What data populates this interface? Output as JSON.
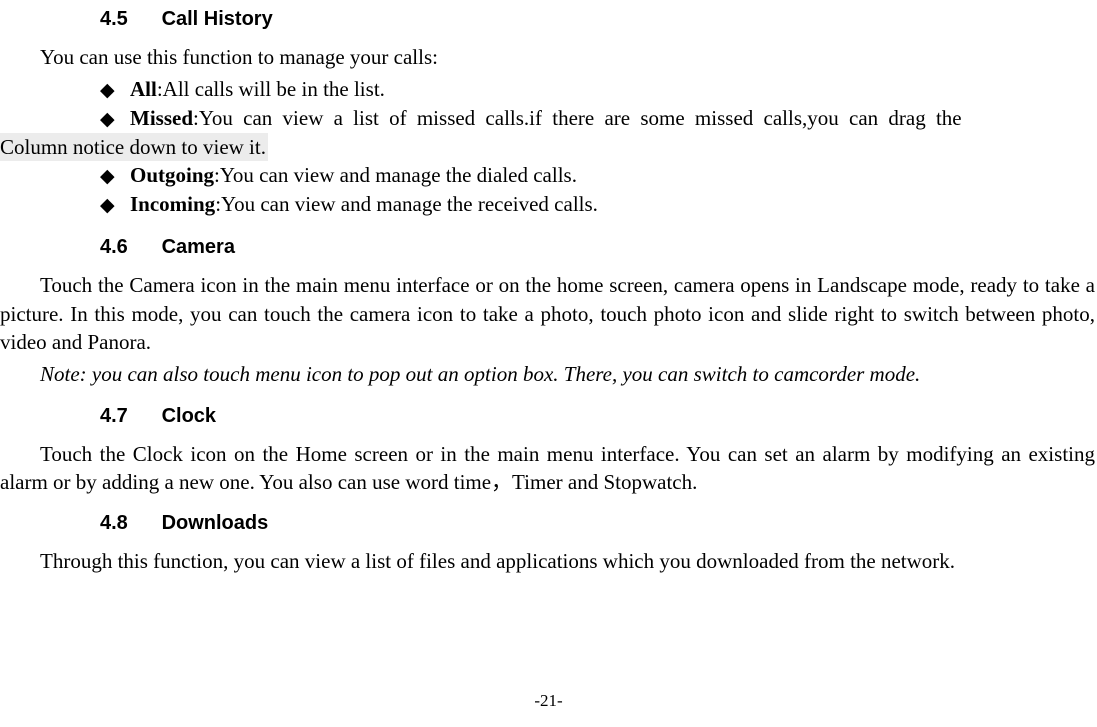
{
  "sections": {
    "s45": {
      "num": "4.5",
      "title": "Call History"
    },
    "s46": {
      "num": "4.6",
      "title": "Camera"
    },
    "s47": {
      "num": "4.7",
      "title": "Clock"
    },
    "s48": {
      "num": "4.8",
      "title": "Downloads"
    }
  },
  "p45_intro": "You can use this function to manage your calls:",
  "list45": {
    "all": {
      "label": "All",
      "text": ":All calls will be in the list."
    },
    "missed": {
      "label": "Missed",
      "text_l1": ":You can view a list of missed calls.if there are some missed calls,you can drag the",
      "text_l2": "Column notice down to view it."
    },
    "outgoing": {
      "label": "Outgoing",
      "text": ":You can view and manage the dialed calls."
    },
    "incoming": {
      "label": "Incoming",
      "text": ":You can view and manage the received calls."
    }
  },
  "p46_body": "Touch the Camera icon in the main menu interface or on the home screen, camera opens in Landscape mode, ready to take a picture. In this mode, you can touch the camera icon to take a photo, touch photo icon and slide right to switch between photo, video and Panora.",
  "p46_note": "Note: you can also touch menu icon to pop out an option box. There, you can switch to camcorder mode.",
  "p47_body": "Touch the Clock icon on the Home screen or in the main menu interface. You can set an alarm by modifying an existing alarm or by adding a new one. You also can use word time，Timer and Stopwatch.",
  "p48_body": "Through this function, you can view a list of files and applications which you downloaded from the network.",
  "footer": "-21-",
  "bullet_glyph": "◆"
}
